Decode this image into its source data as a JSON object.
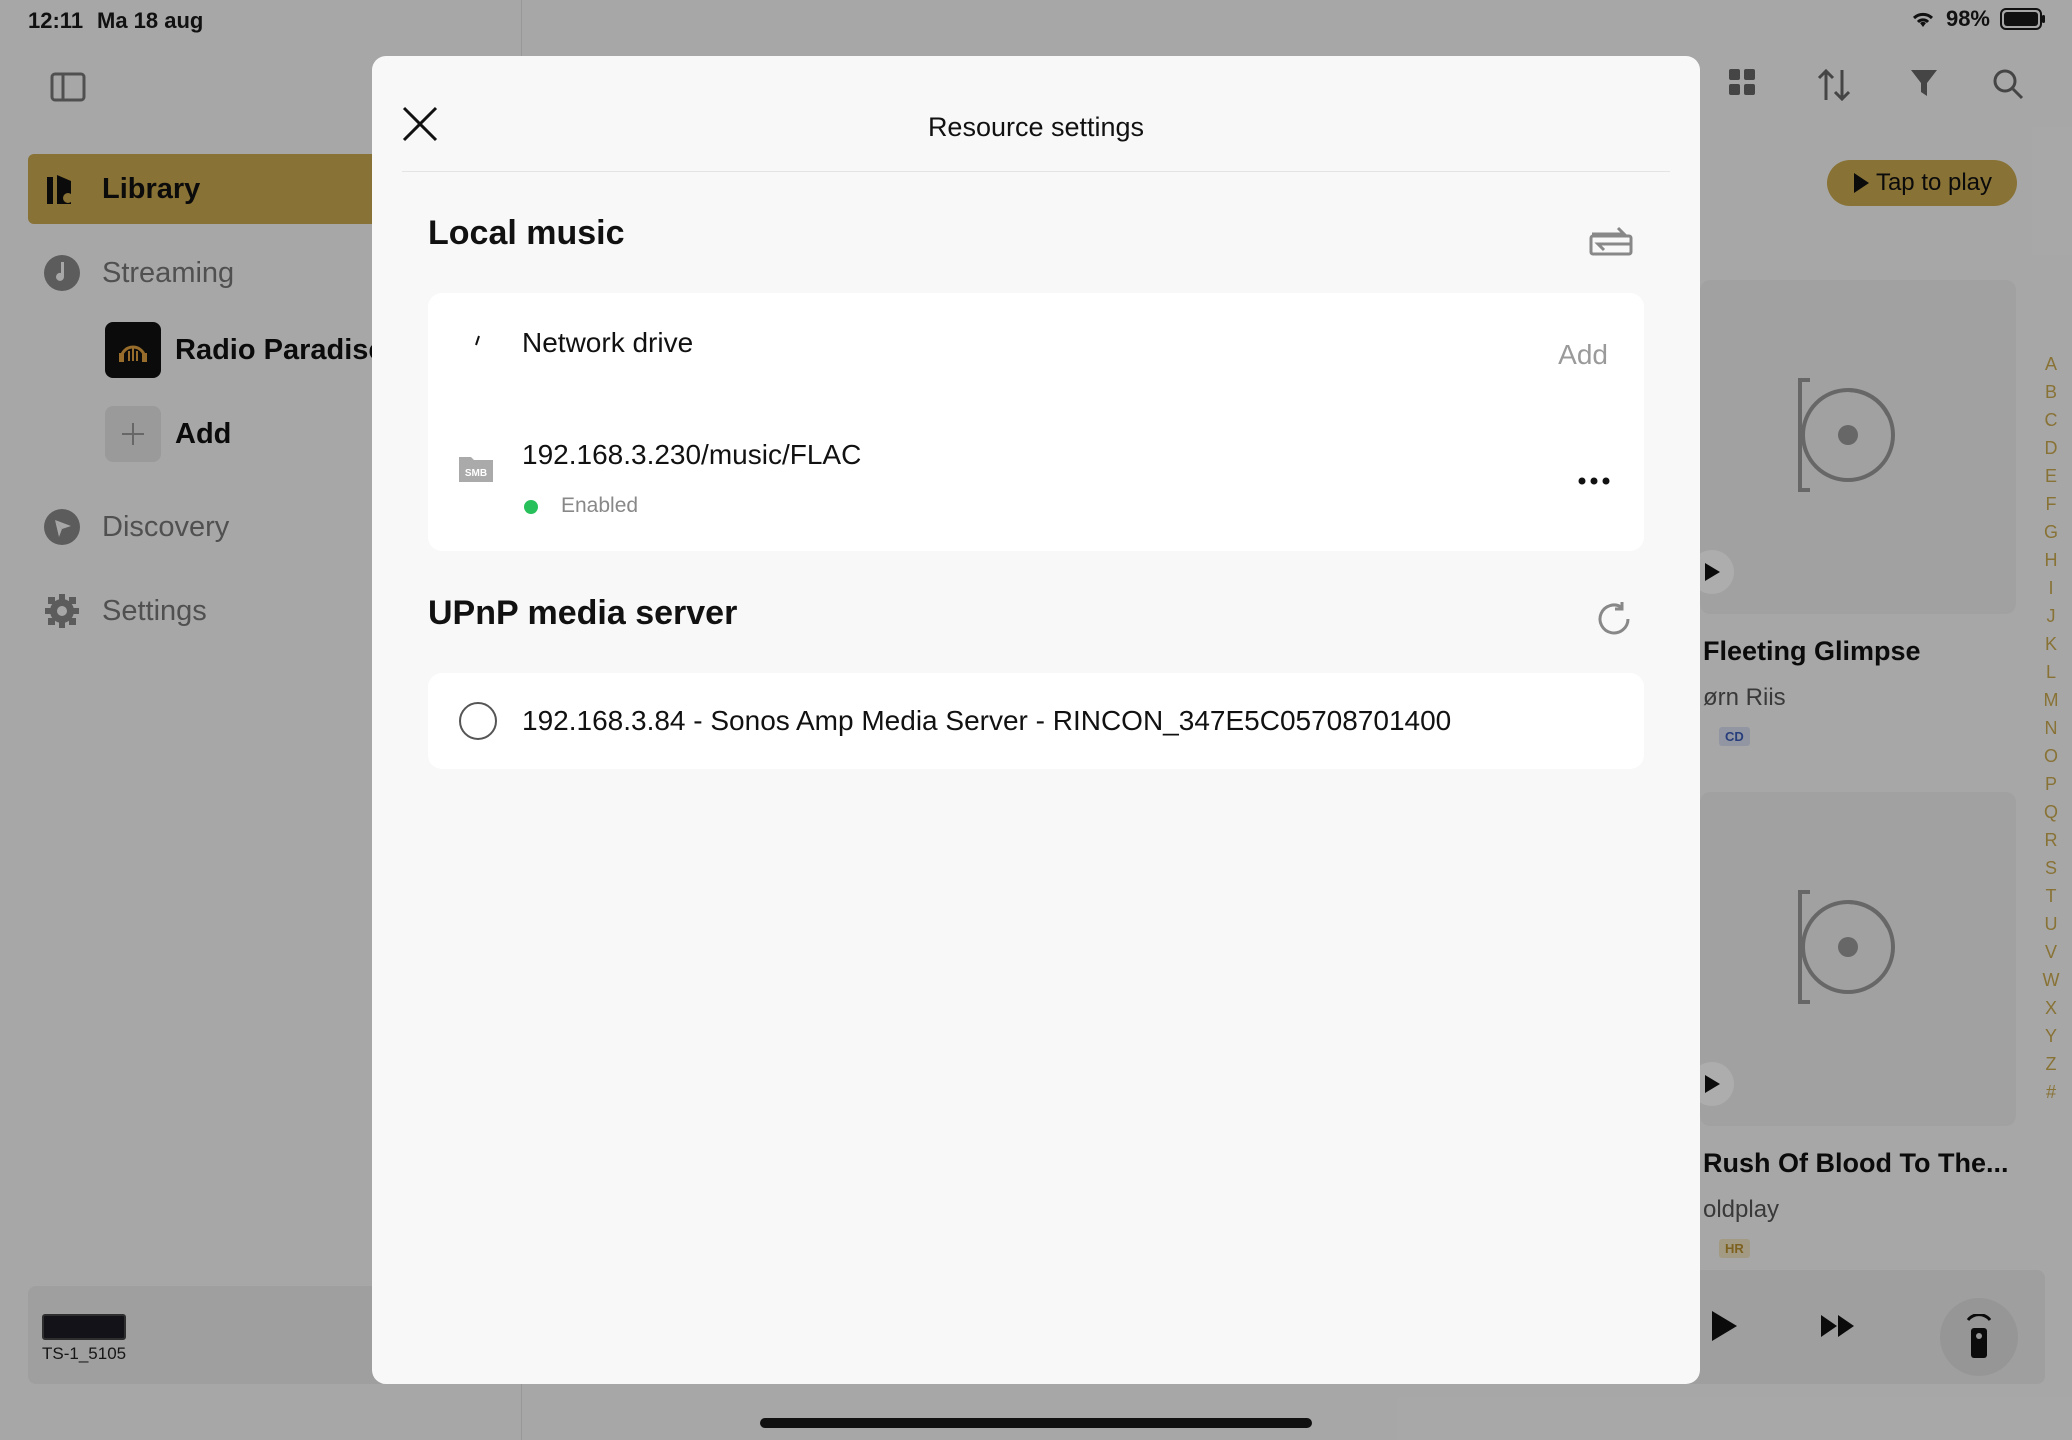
{
  "status_bar": {
    "time": "12:11",
    "date": "Ma 18 aug",
    "battery": "98%"
  },
  "sidebar": {
    "items": [
      {
        "label": "Library",
        "icon": "library-icon",
        "active": true
      },
      {
        "label": "Streaming",
        "icon": "music-note-icon",
        "active": false
      },
      {
        "label": "Discovery",
        "icon": "compass-icon",
        "active": false
      },
      {
        "label": "Settings",
        "icon": "gear-icon",
        "active": false
      }
    ],
    "streaming_services": [
      {
        "label": "Radio Paradise",
        "icon": "radio-paradise-logo"
      },
      {
        "label": "Add",
        "icon": "plus-icon"
      }
    ],
    "device": {
      "label": "TS-1_5105"
    }
  },
  "main": {
    "tap_to_play": "Tap to play",
    "albums": [
      {
        "title": "Fleeting Glimpse",
        "artist": "ørn Riis",
        "badge": "CD",
        "badge_color": "#3b5bb5"
      },
      {
        "title": "Rush Of Blood To The...",
        "artist": "oldplay",
        "badge": "HR",
        "badge_color": "#b8902f"
      }
    ],
    "alphabet": [
      "A",
      "B",
      "C",
      "D",
      "E",
      "F",
      "G",
      "H",
      "I",
      "J",
      "K",
      "L",
      "M",
      "N",
      "O",
      "P",
      "Q",
      "R",
      "S",
      "T",
      "U",
      "V",
      "W",
      "X",
      "Y",
      "Z",
      "#"
    ]
  },
  "modal": {
    "title": "Resource settings",
    "local_music": {
      "title": "Local music",
      "network_drive_label": "Network drive",
      "add_label": "Add",
      "drive": {
        "path": "192.168.3.230/music/FLAC",
        "status": "Enabled",
        "type_badge": "SMB"
      }
    },
    "upnp": {
      "title": "UPnP media server",
      "servers": [
        {
          "label": "192.168.3.84 - Sonos Amp Media Server - RINCON_347E5C05708701400"
        }
      ]
    }
  },
  "colors": {
    "accent": "#c9a84f",
    "status_enabled": "#27c05a"
  }
}
